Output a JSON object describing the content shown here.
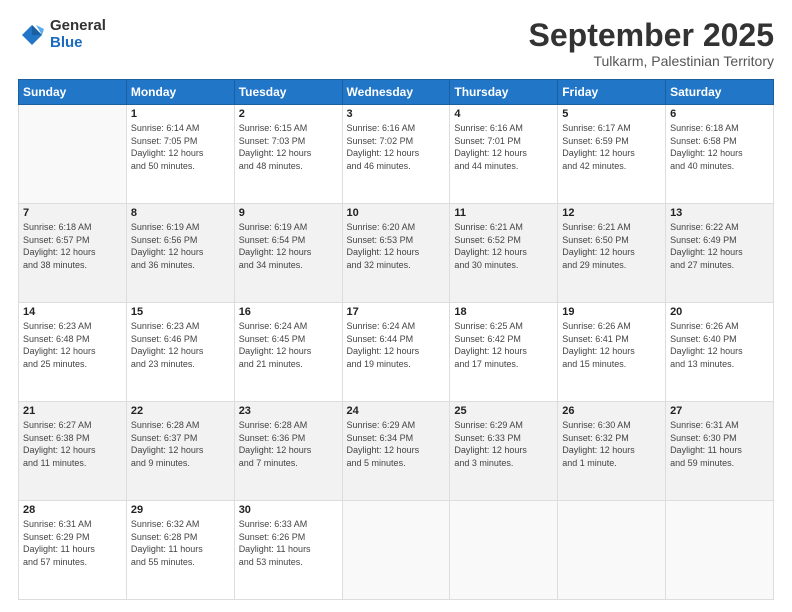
{
  "logo": {
    "general": "General",
    "blue": "Blue"
  },
  "title": "September 2025",
  "location": "Tulkarm, Palestinian Territory",
  "days_header": [
    "Sunday",
    "Monday",
    "Tuesday",
    "Wednesday",
    "Thursday",
    "Friday",
    "Saturday"
  ],
  "weeks": [
    [
      {
        "num": "",
        "info": ""
      },
      {
        "num": "1",
        "info": "Sunrise: 6:14 AM\nSunset: 7:05 PM\nDaylight: 12 hours\nand 50 minutes."
      },
      {
        "num": "2",
        "info": "Sunrise: 6:15 AM\nSunset: 7:03 PM\nDaylight: 12 hours\nand 48 minutes."
      },
      {
        "num": "3",
        "info": "Sunrise: 6:16 AM\nSunset: 7:02 PM\nDaylight: 12 hours\nand 46 minutes."
      },
      {
        "num": "4",
        "info": "Sunrise: 6:16 AM\nSunset: 7:01 PM\nDaylight: 12 hours\nand 44 minutes."
      },
      {
        "num": "5",
        "info": "Sunrise: 6:17 AM\nSunset: 6:59 PM\nDaylight: 12 hours\nand 42 minutes."
      },
      {
        "num": "6",
        "info": "Sunrise: 6:18 AM\nSunset: 6:58 PM\nDaylight: 12 hours\nand 40 minutes."
      }
    ],
    [
      {
        "num": "7",
        "info": "Sunrise: 6:18 AM\nSunset: 6:57 PM\nDaylight: 12 hours\nand 38 minutes."
      },
      {
        "num": "8",
        "info": "Sunrise: 6:19 AM\nSunset: 6:56 PM\nDaylight: 12 hours\nand 36 minutes."
      },
      {
        "num": "9",
        "info": "Sunrise: 6:19 AM\nSunset: 6:54 PM\nDaylight: 12 hours\nand 34 minutes."
      },
      {
        "num": "10",
        "info": "Sunrise: 6:20 AM\nSunset: 6:53 PM\nDaylight: 12 hours\nand 32 minutes."
      },
      {
        "num": "11",
        "info": "Sunrise: 6:21 AM\nSunset: 6:52 PM\nDaylight: 12 hours\nand 30 minutes."
      },
      {
        "num": "12",
        "info": "Sunrise: 6:21 AM\nSunset: 6:50 PM\nDaylight: 12 hours\nand 29 minutes."
      },
      {
        "num": "13",
        "info": "Sunrise: 6:22 AM\nSunset: 6:49 PM\nDaylight: 12 hours\nand 27 minutes."
      }
    ],
    [
      {
        "num": "14",
        "info": "Sunrise: 6:23 AM\nSunset: 6:48 PM\nDaylight: 12 hours\nand 25 minutes."
      },
      {
        "num": "15",
        "info": "Sunrise: 6:23 AM\nSunset: 6:46 PM\nDaylight: 12 hours\nand 23 minutes."
      },
      {
        "num": "16",
        "info": "Sunrise: 6:24 AM\nSunset: 6:45 PM\nDaylight: 12 hours\nand 21 minutes."
      },
      {
        "num": "17",
        "info": "Sunrise: 6:24 AM\nSunset: 6:44 PM\nDaylight: 12 hours\nand 19 minutes."
      },
      {
        "num": "18",
        "info": "Sunrise: 6:25 AM\nSunset: 6:42 PM\nDaylight: 12 hours\nand 17 minutes."
      },
      {
        "num": "19",
        "info": "Sunrise: 6:26 AM\nSunset: 6:41 PM\nDaylight: 12 hours\nand 15 minutes."
      },
      {
        "num": "20",
        "info": "Sunrise: 6:26 AM\nSunset: 6:40 PM\nDaylight: 12 hours\nand 13 minutes."
      }
    ],
    [
      {
        "num": "21",
        "info": "Sunrise: 6:27 AM\nSunset: 6:38 PM\nDaylight: 12 hours\nand 11 minutes."
      },
      {
        "num": "22",
        "info": "Sunrise: 6:28 AM\nSunset: 6:37 PM\nDaylight: 12 hours\nand 9 minutes."
      },
      {
        "num": "23",
        "info": "Sunrise: 6:28 AM\nSunset: 6:36 PM\nDaylight: 12 hours\nand 7 minutes."
      },
      {
        "num": "24",
        "info": "Sunrise: 6:29 AM\nSunset: 6:34 PM\nDaylight: 12 hours\nand 5 minutes."
      },
      {
        "num": "25",
        "info": "Sunrise: 6:29 AM\nSunset: 6:33 PM\nDaylight: 12 hours\nand 3 minutes."
      },
      {
        "num": "26",
        "info": "Sunrise: 6:30 AM\nSunset: 6:32 PM\nDaylight: 12 hours\nand 1 minute."
      },
      {
        "num": "27",
        "info": "Sunrise: 6:31 AM\nSunset: 6:30 PM\nDaylight: 11 hours\nand 59 minutes."
      }
    ],
    [
      {
        "num": "28",
        "info": "Sunrise: 6:31 AM\nSunset: 6:29 PM\nDaylight: 11 hours\nand 57 minutes."
      },
      {
        "num": "29",
        "info": "Sunrise: 6:32 AM\nSunset: 6:28 PM\nDaylight: 11 hours\nand 55 minutes."
      },
      {
        "num": "30",
        "info": "Sunrise: 6:33 AM\nSunset: 6:26 PM\nDaylight: 11 hours\nand 53 minutes."
      },
      {
        "num": "",
        "info": ""
      },
      {
        "num": "",
        "info": ""
      },
      {
        "num": "",
        "info": ""
      },
      {
        "num": "",
        "info": ""
      }
    ]
  ]
}
